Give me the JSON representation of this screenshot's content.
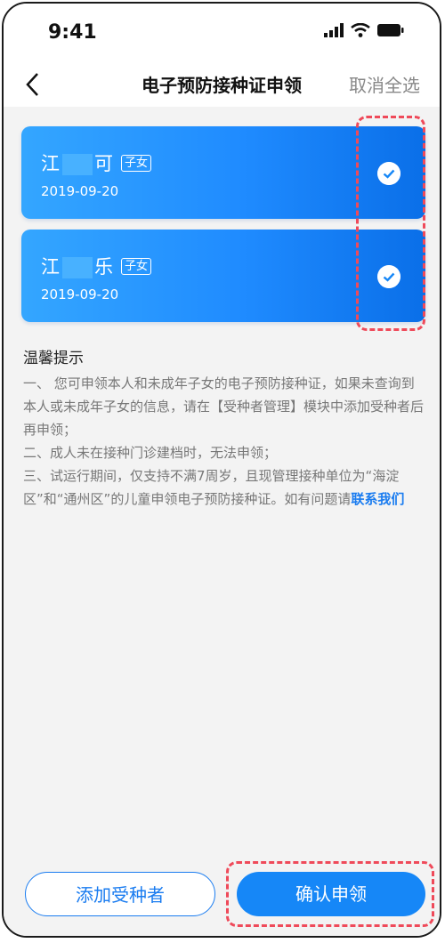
{
  "status_bar": {
    "time": "9:41"
  },
  "header": {
    "back_icon": "chevron-left-icon",
    "title": "电子预防接种证申领",
    "cancel_all": "取消全选"
  },
  "cards": [
    {
      "name_first": "江",
      "name_last": "可",
      "relation": "子女",
      "date": "2019-09-20",
      "checked": true
    },
    {
      "name_first": "江",
      "name_last": "乐",
      "relation": "子女",
      "date": "2019-09-20",
      "checked": true
    }
  ],
  "tips": {
    "title": "温馨提示",
    "line1": "一、 您可申领本人和未成年子女的电子预防接种证，如果未查询到本人或未成年子女的信息，请在【受种者管理】模块中添加受种者后再申领；",
    "line2": "二、成人未在接种门诊建档时，无法申领；",
    "line3_prefix": "三、试运行期间，仅支持不满7周岁，且现管理接种单位为“海淀区”和“通州区”的儿童申领电子预防接种证。如有问题请",
    "line3_link": "联系我们"
  },
  "footer": {
    "add_button": "添加受种者",
    "confirm_button": "确认申领"
  },
  "colors": {
    "accent": "#1687f7",
    "highlight": "#ef4a5a"
  }
}
